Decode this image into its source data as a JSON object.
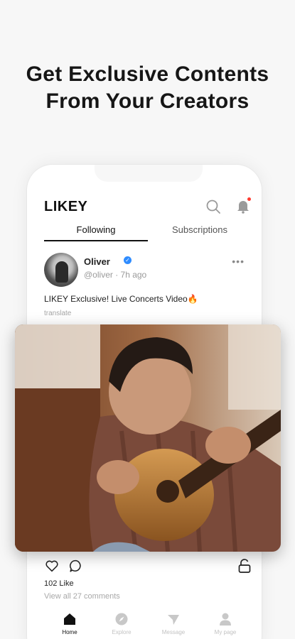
{
  "headline": {
    "line1": "Get Exclusive Contents",
    "line2": "From Your Creators"
  },
  "app": {
    "logo": "LIKEY"
  },
  "tabs": [
    {
      "label": "Following",
      "active": true
    },
    {
      "label": "Subscriptions",
      "active": false
    }
  ],
  "post": {
    "author": "Oliver",
    "handle": "@oliver",
    "time": "7h ago",
    "meta": "@oliver · 7h ago",
    "caption": "LIKEY Exclusive! Live Concerts Video🔥",
    "translate": "translate",
    "likes": "102 Like",
    "comments_link": "View all 27 comments"
  },
  "nav": [
    {
      "label": "Home",
      "icon": "home-icon",
      "active": true
    },
    {
      "label": "Explore",
      "icon": "compass-icon",
      "active": false
    },
    {
      "label": "Message",
      "icon": "send-icon",
      "active": false
    },
    {
      "label": "My page",
      "icon": "user-icon",
      "active": false
    }
  ],
  "colors": {
    "accent": "#111111",
    "verified": "#2f8cff",
    "notification": "#ff3b30",
    "muted": "#9a9a9a"
  }
}
